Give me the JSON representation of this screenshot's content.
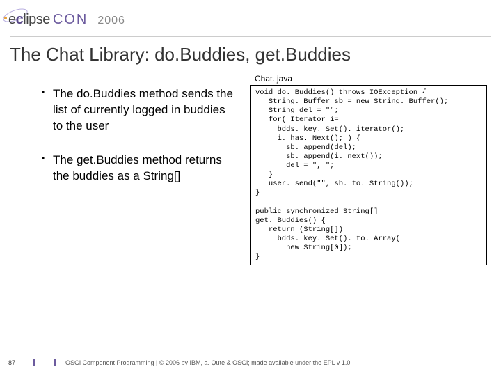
{
  "header": {
    "brand_a": "eclipse",
    "brand_b": "CON",
    "year": "2006"
  },
  "title": "The Chat Library: do.Buddies, get.Buddies",
  "bullets": [
    "The do.Buddies method sends the list of currently logged in buddies to the user",
    "The get.Buddies method returns the buddies as a String[]"
  ],
  "code": {
    "filename": "Chat. java",
    "body": "void do. Buddies() throws IOException {\n   String. Buffer sb = new String. Buffer();\n   String del = \"\";\n   for( Iterator i=\n     bdds. key. Set(). iterator();\n     i. has. Next(); ) {\n       sb. append(del);\n       sb. append(i. next());\n       del = \", \";\n   }\n   user. send(\"\", sb. to. String());\n}\n\npublic synchronized String[]\nget. Buddies() {\n   return (String[])\n     bdds. key. Set(). to. Array(\n       new String[0]);\n}"
  },
  "footer": {
    "page": "87",
    "text": "OSGi Component Programming | © 2006 by IBM, a. Qute & OSGi; made available under the EPL v 1.0"
  }
}
